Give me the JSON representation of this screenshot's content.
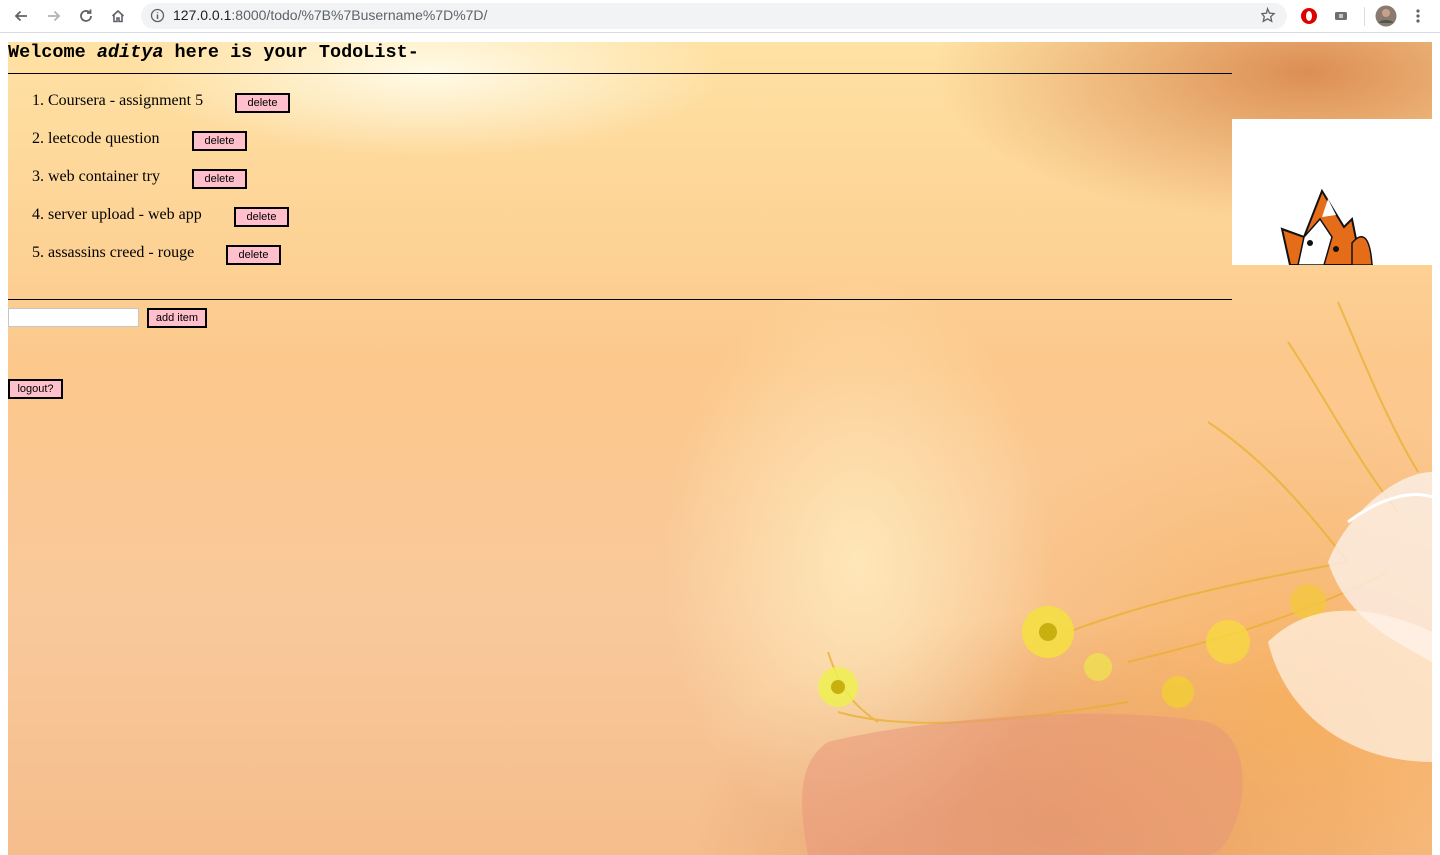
{
  "browser": {
    "url_host": "127.0.0.1",
    "url_path": ":8000/todo/%7B%7Busername%7D%7D/",
    "icons": [
      "back-icon",
      "forward-icon",
      "reload-icon",
      "home-icon",
      "info-icon",
      "star-icon",
      "opera-extension-icon",
      "extension-icon",
      "profile-avatar-icon",
      "more-menu-icon"
    ]
  },
  "page": {
    "welcome_prefix": "Welcome ",
    "username": "aditya",
    "welcome_suffix": " here is your TodoList-",
    "todos": [
      {
        "number": "1.",
        "text": "Coursera - assignment 5",
        "delete_label": "delete"
      },
      {
        "number": "2.",
        "text": "leetcode question",
        "delete_label": "delete"
      },
      {
        "number": "3.",
        "text": "web container try",
        "delete_label": "delete"
      },
      {
        "number": "4.",
        "text": "server upload - web app",
        "delete_label": "delete"
      },
      {
        "number": "5.",
        "text": "assassins creed - rouge",
        "delete_label": "delete"
      }
    ],
    "new_item_value": "",
    "add_item_label": "add item",
    "logout_label": "logout?"
  },
  "colors": {
    "button_bg": "#ffc0cb",
    "page_bg": "#fcc88c"
  }
}
